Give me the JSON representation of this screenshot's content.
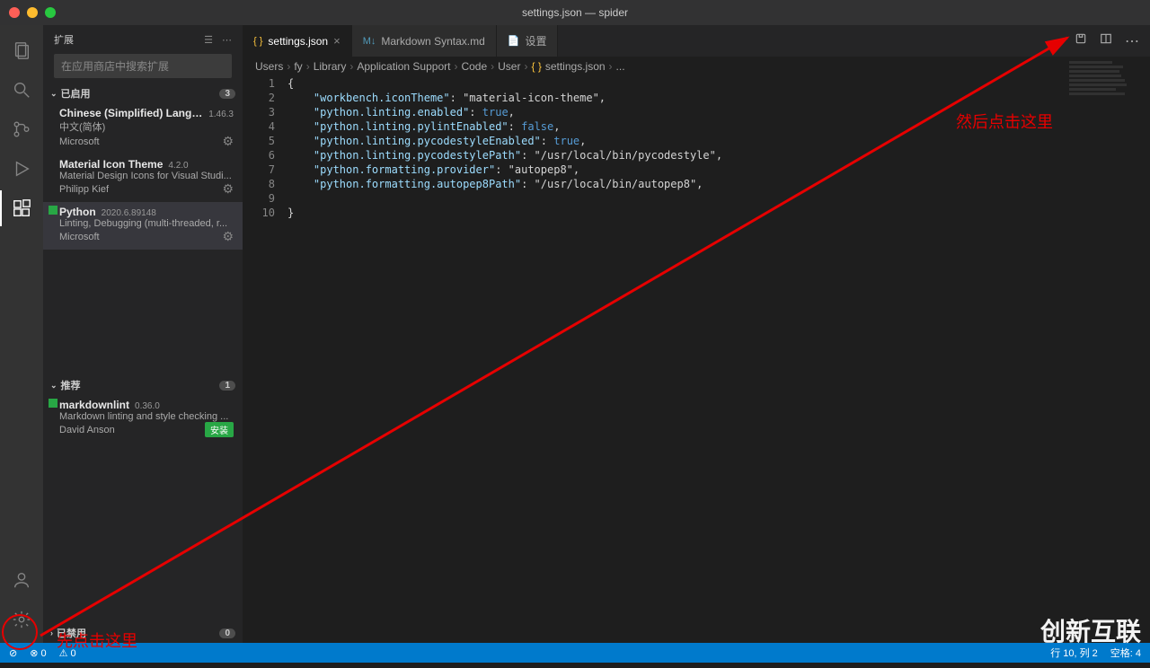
{
  "window": {
    "title": "settings.json — spider"
  },
  "activity": {
    "items": [
      "explorer",
      "search",
      "scm",
      "debug",
      "extensions"
    ],
    "active": 4,
    "bottom": [
      "account",
      "settings"
    ]
  },
  "sidebar": {
    "title": "扩展",
    "search_placeholder": "在应用商店中搜索扩展",
    "sections": {
      "enabled": {
        "label": "已启用",
        "count": "3"
      },
      "recommended": {
        "label": "推荐",
        "count": "1"
      },
      "disabled": {
        "label": "已禁用",
        "count": "0"
      }
    },
    "enabled_items": [
      {
        "name": "Chinese (Simplified) Langua...",
        "version": "1.46.3",
        "desc": "中文(简体)",
        "publisher": "Microsoft"
      },
      {
        "name": "Material Icon Theme",
        "version": "4.2.0",
        "desc": "Material Design Icons for Visual Studi...",
        "publisher": "Philipp Kief"
      },
      {
        "name": "Python",
        "version": "2020.6.89148",
        "desc": "Linting, Debugging (multi-threaded, r...",
        "publisher": "Microsoft",
        "starred": true,
        "selected": true
      }
    ],
    "recommended_items": [
      {
        "name": "markdownlint",
        "version": "0.36.0",
        "desc": "Markdown linting and style checking ...",
        "publisher": "David Anson",
        "install": "安装",
        "starred": true
      }
    ]
  },
  "tabs": [
    {
      "icon": "json",
      "label": "settings.json",
      "active": true,
      "close": true
    },
    {
      "icon": "md",
      "label": "Markdown Syntax.md"
    },
    {
      "icon": "set",
      "label": "设置"
    }
  ],
  "tab_actions": {
    "split": "⬚",
    "layout": "▥",
    "more": "⋯"
  },
  "breadcrumb": [
    "Users",
    "fy",
    "Library",
    "Application Support",
    "Code",
    "User",
    "settings.json",
    "..."
  ],
  "code": {
    "lines": [
      "{",
      "    \"workbench.iconTheme\": \"material-icon-theme\",",
      "    \"python.linting.enabled\": true,",
      "    \"python.linting.pylintEnabled\": false,",
      "    \"python.linting.pycodestyleEnabled\": true,",
      "    \"python.linting.pycodestylePath\": \"/usr/local/bin/pycodestyle\",",
      "    \"python.formatting.provider\": \"autopep8\",",
      "    \"python.formatting.autopep8Path\": \"/usr/local/bin/autopep8\",",
      "",
      "}"
    ],
    "keys": [
      "workbench.iconTheme",
      "python.linting.enabled",
      "python.linting.pylintEnabled",
      "python.linting.pycodestyleEnabled",
      "python.linting.pycodestylePath",
      "python.formatting.provider",
      "python.formatting.autopep8Path"
    ],
    "values": [
      "material-icon-theme",
      "true",
      "false",
      "true",
      "/usr/local/bin/pycodestyle",
      "autopep8",
      "/usr/local/bin/autopep8"
    ]
  },
  "statusbar": {
    "left": {
      "errors": "0",
      "warnings": "0"
    },
    "right": {
      "pos": "行 10, 列 2",
      "spaces": "空格: 4"
    }
  },
  "annotations": {
    "bottom": "先点击这里",
    "top": "然后点击这里"
  },
  "watermark": "创新互联"
}
